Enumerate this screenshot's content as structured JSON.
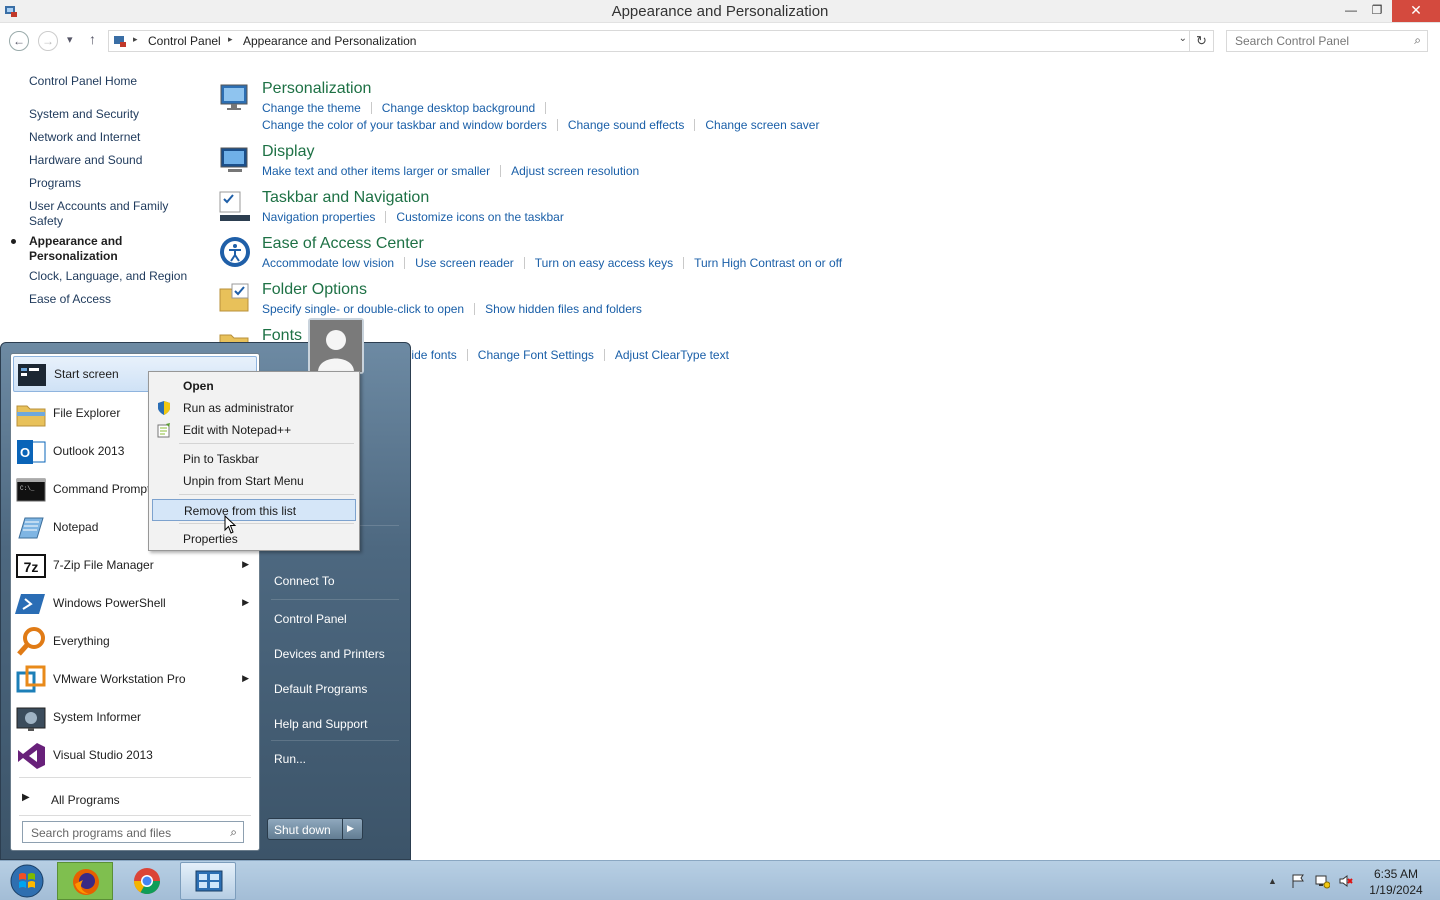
{
  "window": {
    "title": "Appearance and Personalization",
    "minimize_glyph": "—",
    "restore_glyph": "❐",
    "close_glyph": "✕"
  },
  "addressbar": {
    "crumbs": [
      "Control Panel",
      "Appearance and Personalization"
    ],
    "search_placeholder": "Search Control Panel"
  },
  "leftnav": {
    "home": "Control Panel Home",
    "items": [
      "System and Security",
      "Network and Internet",
      "Hardware and Sound",
      "Programs",
      "User Accounts and Family Safety",
      "Appearance and Personalization",
      "Clock, Language, and Region",
      "Ease of Access"
    ],
    "active_index": 5
  },
  "categories": [
    {
      "title": "Personalization",
      "icon": "personalization-icon",
      "links_row1": [
        "Change the theme",
        "Change desktop background"
      ],
      "links_row2": [
        "Change the color of your taskbar and window borders",
        "Change sound effects",
        "Change screen saver"
      ]
    },
    {
      "title": "Display",
      "icon": "display-icon",
      "links_row1": [
        "Make text and other items larger or smaller",
        "Adjust screen resolution"
      ]
    },
    {
      "title": "Taskbar and Navigation",
      "icon": "taskbar-icon",
      "links_row1": [
        "Navigation properties",
        "Customize icons on the taskbar"
      ]
    },
    {
      "title": "Ease of Access Center",
      "icon": "ease-of-access-icon",
      "links_row1": [
        "Accommodate low vision",
        "Use screen reader",
        "Turn on easy access keys",
        "Turn High Contrast on or off"
      ]
    },
    {
      "title": "Folder Options",
      "icon": "folder-options-icon",
      "links_row1": [
        "Specify single- or double-click to open",
        "Show hidden files and folders"
      ]
    },
    {
      "title": "Fonts",
      "icon": "fonts-icon",
      "links_row1": [
        "Preview, delete, show and hide fonts",
        "Change Font Settings",
        "Adjust ClearType text"
      ]
    }
  ],
  "startmenu": {
    "programs": [
      {
        "label": "Start screen",
        "icon": "start-screen-icon",
        "submenu": false,
        "highlighted": true
      },
      {
        "label": "File Explorer",
        "icon": "file-explorer-icon",
        "submenu": false
      },
      {
        "label": "Outlook 2013",
        "icon": "outlook-icon",
        "submenu": false
      },
      {
        "label": "Command Prompt",
        "icon": "command-prompt-icon",
        "submenu": false
      },
      {
        "label": "Notepad",
        "icon": "notepad-icon",
        "submenu": false
      },
      {
        "label": "7-Zip File Manager",
        "icon": "7zip-icon",
        "submenu": true
      },
      {
        "label": "Windows PowerShell",
        "icon": "powershell-icon",
        "submenu": true
      },
      {
        "label": "Everything",
        "icon": "everything-icon",
        "submenu": false
      },
      {
        "label": "VMware Workstation Pro",
        "icon": "vmware-icon",
        "submenu": true
      },
      {
        "label": "System Informer",
        "icon": "system-informer-icon",
        "submenu": false
      },
      {
        "label": "Visual Studio 2013",
        "icon": "visual-studio-icon",
        "submenu": false
      }
    ],
    "all_programs": "All Programs",
    "search_placeholder": "Search programs and files",
    "right_items": [
      "Connect To",
      "Control Panel",
      "Devices and Printers",
      "Default Programs",
      "Help and Support",
      "Run..."
    ],
    "shutdown": "Shut down"
  },
  "context_menu": {
    "items": [
      {
        "label": "Open",
        "bold": true
      },
      {
        "label": "Run as administrator",
        "icon": "uac-shield-icon"
      },
      {
        "label": "Edit with Notepad++",
        "icon": "notepadpp-icon"
      },
      {
        "separator": true
      },
      {
        "label": "Pin to Taskbar"
      },
      {
        "label": "Unpin from Start Menu"
      },
      {
        "separator": true
      },
      {
        "label": "Remove from this list",
        "highlighted": true
      },
      {
        "separator": true
      },
      {
        "label": "Properties"
      }
    ]
  },
  "taskbar": {
    "buttons": [
      "start-orb-icon",
      "firefox-icon",
      "chrome-icon",
      "control-panel-icon"
    ],
    "active_index": 3,
    "tray_icons": [
      "show-hidden-icons",
      "action-center-flag-icon",
      "network-icon",
      "volume-muted-icon"
    ],
    "time": "6:35 AM",
    "date": "1/19/2024"
  },
  "colors": {
    "link": "#1a5fa8",
    "category_title": "#1e7145",
    "taskbar": "#a3bdd6"
  }
}
